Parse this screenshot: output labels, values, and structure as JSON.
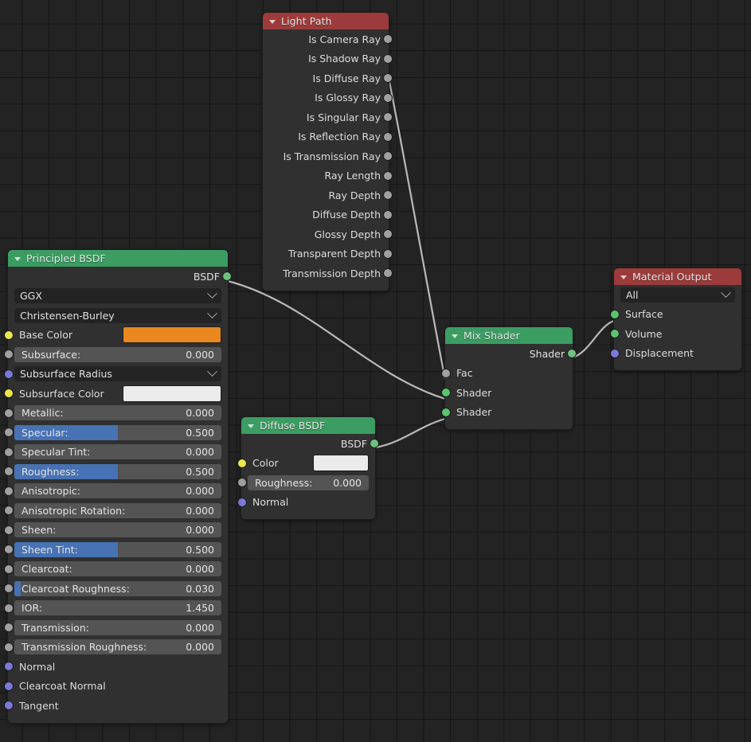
{
  "editor": {
    "name": "blender-shader-node-editor",
    "background": "#232323",
    "grid_color": "#1b1b1b"
  },
  "colors": {
    "header_red": "#9c3b3b",
    "header_green": "#3b9d62",
    "node_body": "#303030",
    "slider_track": "#545454",
    "slider_fill": "#4772b3",
    "socket_shader": "#6ec07e",
    "socket_gray": "#a0a0a0",
    "socket_yellow": "#e8e84a",
    "socket_purple": "#7a78d8",
    "base_color_swatch": "#e8881f",
    "subsurface_color_swatch": "#ebebeb",
    "diffuse_color_swatch": "#ebebeb",
    "noodle": "#b9b9b9"
  },
  "nodes": {
    "light_path": {
      "title": "Light Path",
      "outputs": [
        {
          "label": "Is Camera Ray",
          "socket": "gray"
        },
        {
          "label": "Is Shadow Ray",
          "socket": "gray"
        },
        {
          "label": "Is Diffuse Ray",
          "socket": "gray"
        },
        {
          "label": "Is Glossy Ray",
          "socket": "gray"
        },
        {
          "label": "Is Singular Ray",
          "socket": "gray"
        },
        {
          "label": "Is Reflection Ray",
          "socket": "gray"
        },
        {
          "label": "Is Transmission Ray",
          "socket": "gray"
        },
        {
          "label": "Ray Length",
          "socket": "gray"
        },
        {
          "label": "Ray Depth",
          "socket": "gray"
        },
        {
          "label": "Diffuse Depth",
          "socket": "gray"
        },
        {
          "label": "Glossy Depth",
          "socket": "gray"
        },
        {
          "label": "Transparent Depth",
          "socket": "gray"
        },
        {
          "label": "Transmission Depth",
          "socket": "gray"
        }
      ]
    },
    "principled_bsdf": {
      "title": "Principled BSDF",
      "output_label": "BSDF",
      "distribution": "GGX",
      "subsurface_method": "Christensen-Burley",
      "inputs": [
        {
          "label": "Base Color",
          "type": "color",
          "value": "#e8881f",
          "socket": "yellow"
        },
        {
          "label": "Subsurface:",
          "type": "slider",
          "value": "0.000",
          "fill": 0,
          "socket": "gray"
        },
        {
          "label": "Subsurface Radius",
          "type": "dropdown",
          "value": "",
          "socket": "purple"
        },
        {
          "label": "Subsurface Color",
          "type": "color",
          "value": "#ebebeb",
          "socket": "yellow"
        },
        {
          "label": "Metallic:",
          "type": "slider",
          "value": "0.000",
          "fill": 0,
          "socket": "gray"
        },
        {
          "label": "Specular:",
          "type": "slider",
          "value": "0.500",
          "fill": 50,
          "socket": "gray"
        },
        {
          "label": "Specular Tint:",
          "type": "slider",
          "value": "0.000",
          "fill": 0,
          "socket": "gray"
        },
        {
          "label": "Roughness:",
          "type": "slider",
          "value": "0.500",
          "fill": 50,
          "socket": "gray"
        },
        {
          "label": "Anisotropic:",
          "type": "slider",
          "value": "0.000",
          "fill": 0,
          "socket": "gray"
        },
        {
          "label": "Anisotropic Rotation:",
          "type": "slider",
          "value": "0.000",
          "fill": 0,
          "socket": "gray"
        },
        {
          "label": "Sheen:",
          "type": "slider",
          "value": "0.000",
          "fill": 0,
          "socket": "gray"
        },
        {
          "label": "Sheen Tint:",
          "type": "slider",
          "value": "0.500",
          "fill": 50,
          "socket": "gray"
        },
        {
          "label": "Clearcoat:",
          "type": "slider",
          "value": "0.000",
          "fill": 0,
          "socket": "gray"
        },
        {
          "label": "Clearcoat Roughness:",
          "type": "slider",
          "value": "0.030",
          "fill": 3,
          "socket": "gray"
        },
        {
          "label": "IOR:",
          "type": "slider",
          "value": "1.450",
          "fill": 0,
          "socket": "gray"
        },
        {
          "label": "Transmission:",
          "type": "slider",
          "value": "0.000",
          "fill": 0,
          "socket": "gray"
        },
        {
          "label": "Transmission Roughness:",
          "type": "slider",
          "value": "0.000",
          "fill": 0,
          "socket": "gray"
        },
        {
          "label": "Normal",
          "type": "plain",
          "value": "",
          "socket": "purple"
        },
        {
          "label": "Clearcoat Normal",
          "type": "plain",
          "value": "",
          "socket": "purple"
        },
        {
          "label": "Tangent",
          "type": "plain",
          "value": "",
          "socket": "purple"
        }
      ]
    },
    "diffuse_bsdf": {
      "title": "Diffuse BSDF",
      "output_label": "BSDF",
      "inputs": [
        {
          "label": "Color",
          "type": "color",
          "value": "#ebebeb",
          "socket": "yellow"
        },
        {
          "label": "Roughness:",
          "type": "slider",
          "value": "0.000",
          "fill": 0,
          "socket": "gray"
        },
        {
          "label": "Normal",
          "type": "plain",
          "value": "",
          "socket": "purple"
        }
      ]
    },
    "mix_shader": {
      "title": "Mix Shader",
      "output_label": "Shader",
      "inputs": [
        {
          "label": "Fac",
          "socket": "gray"
        },
        {
          "label": "Shader",
          "socket": "green"
        },
        {
          "label": "Shader",
          "socket": "green"
        }
      ]
    },
    "material_output": {
      "title": "Material Output",
      "target": "All",
      "inputs": [
        {
          "label": "Surface",
          "socket": "green"
        },
        {
          "label": "Volume",
          "socket": "green"
        },
        {
          "label": "Displacement",
          "socket": "purple"
        }
      ]
    }
  },
  "links": [
    {
      "from": "light-path.is-diffuse-ray",
      "to": "mix-shader.fac"
    },
    {
      "from": "principled-bsdf.bsdf",
      "to": "mix-shader.shader-1"
    },
    {
      "from": "diffuse-bsdf.bsdf",
      "to": "mix-shader.shader-2"
    },
    {
      "from": "mix-shader.shader",
      "to": "material-output.surface"
    }
  ]
}
